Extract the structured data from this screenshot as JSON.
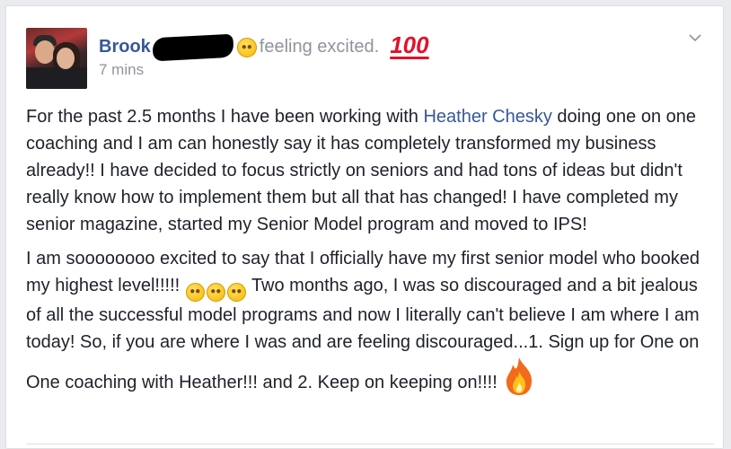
{
  "post": {
    "author": "Brook",
    "activity": "feeling excited.",
    "activity_emoji": "grinning-face-emoji",
    "activity_extra_emoji": "hundred-points-emoji",
    "hundred_text": "100",
    "timestamp": "7 mins",
    "paragraph1": {
      "before_mention": "For the past 2.5 months I have been working with ",
      "mention": "Heather Chesky",
      "after_mention": " doing one on one coaching and I am can honestly say it has completely transformed my business already!! I have decided to focus strictly on seniors and had tons of ideas but didn't really know how to implement them but all that has changed! I have completed my senior magazine, started my Senior Model program and moved to IPS!"
    },
    "paragraph2": {
      "before_emojis": "I am soooooooo excited to say that I officially have my first senior model who booked my highest level!!!!! ",
      "after_emojis": " Two months ago, I was so discouraged and a bit jealous of all the successful model programs and now I literally can't believe I am where I am today! So, if you are where I was and are feeling discouraged...1. Sign up for One on One coaching with Heather!!! and 2. Keep on keeping on!!!!",
      "trailing_emoji": "fire-emoji"
    }
  },
  "colors": {
    "link": "#365899",
    "text": "#1d2129",
    "meta": "#90949c",
    "background": "#e9ebee"
  }
}
